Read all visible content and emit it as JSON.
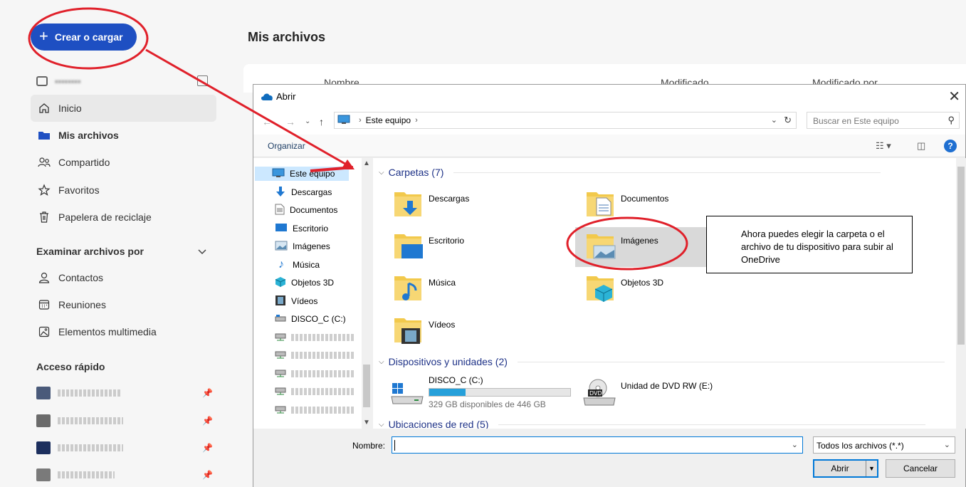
{
  "onedrive": {
    "create_label": "Crear o cargar",
    "page_title": "Mis archivos",
    "account_label": "••••••••",
    "nav": [
      {
        "label": "Inicio",
        "icon": "home-icon"
      },
      {
        "label": "Mis archivos",
        "icon": "folder-icon"
      },
      {
        "label": "Compartido",
        "icon": "people-icon"
      },
      {
        "label": "Favoritos",
        "icon": "star-icon"
      },
      {
        "label": "Papelera de reciclaje",
        "icon": "trash-icon"
      }
    ],
    "browse_heading": "Examinar archivos por",
    "browse": [
      {
        "label": "Contactos",
        "icon": "person-icon"
      },
      {
        "label": "Reuniones",
        "icon": "calendar-icon"
      },
      {
        "label": "Elementos multimedia",
        "icon": "image-icon"
      }
    ],
    "quick_access_heading": "Acceso rápido",
    "columns": {
      "name": "Nombre",
      "modified": "Modificado",
      "modified_by": "Modificado por"
    }
  },
  "dialog": {
    "title": "Abrir",
    "address_location": "Este equipo",
    "search_placeholder": "Buscar en Este equipo",
    "organize_label": "Organizar",
    "tree": [
      {
        "label": "Este equipo",
        "icon": "computer-icon"
      },
      {
        "label": "Descargas",
        "icon": "download-icon"
      },
      {
        "label": "Documentos",
        "icon": "document-icon"
      },
      {
        "label": "Escritorio",
        "icon": "desktop-icon"
      },
      {
        "label": "Imágenes",
        "icon": "pictures-icon"
      },
      {
        "label": "Música",
        "icon": "music-icon"
      },
      {
        "label": "Objetos 3D",
        "icon": "cube-icon"
      },
      {
        "label": "Vídeos",
        "icon": "video-icon"
      },
      {
        "label": "DISCO_C (C:)",
        "icon": "drive-icon"
      }
    ],
    "groups": {
      "folders": "Carpetas (7)",
      "devices": "Dispositivos y unidades (2)",
      "network": "Ubicaciones de red (5)"
    },
    "folders": [
      {
        "label": "Descargas",
        "icon": "download-folder-icon"
      },
      {
        "label": "Documentos",
        "icon": "documents-folder-icon"
      },
      {
        "label": "Escritorio",
        "icon": "desktop-folder-icon"
      },
      {
        "label": "Imágenes",
        "icon": "pictures-folder-icon"
      },
      {
        "label": "Música",
        "icon": "music-folder-icon"
      },
      {
        "label": "Objetos 3D",
        "icon": "3d-objects-folder-icon"
      },
      {
        "label": "Vídeos",
        "icon": "videos-folder-icon"
      }
    ],
    "drives": [
      {
        "label": "DISCO_C (C:)",
        "free_text": "329 GB disponibles de 446 GB",
        "used_fraction": 0.26
      },
      {
        "label": "Unidad de DVD RW (E:)"
      }
    ],
    "filename_label": "Nombre:",
    "filename_value": "",
    "filter_value": "Todos los archivos (*.*)",
    "open_label": "Abrir",
    "cancel_label": "Cancelar"
  },
  "annotation": {
    "callout_text": "Ahora puedes elegir la carpeta o el archivo de tu dispositivo para subir al OneDrive",
    "colors": {
      "circle": "#e0202a",
      "arrow": "#e0202a"
    }
  }
}
